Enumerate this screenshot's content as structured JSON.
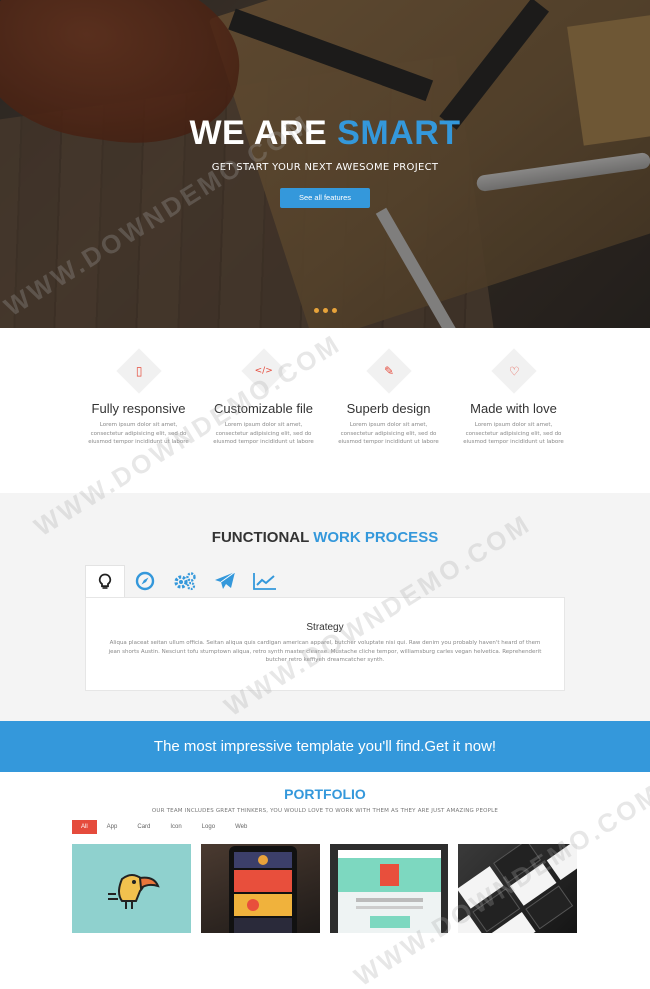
{
  "hero": {
    "title_main": "WE ARE",
    "title_accent": "SMART",
    "subtitle": "GET START YOUR NEXT AWESOME PROJECT",
    "button_label": "See all features",
    "slides": 3
  },
  "features": [
    {
      "icon": "mobile-icon",
      "glyph": "▯",
      "title": "Fully responsive",
      "text": "Lorem ipsum dolor sit amet, consectetur adipisicing elit, sed do eiusmod tempor incididunt ut labore"
    },
    {
      "icon": "code-icon",
      "glyph": "</>",
      "title": "Customizable file",
      "text": "Lorem ipsum dolor sit amet, consectetur adipisicing elit, sed do eiusmod tempor incididunt ut labore"
    },
    {
      "icon": "paintbrush-icon",
      "glyph": "✎",
      "title": "Superb design",
      "text": "Lorem ipsum dolor sit amet, consectetur adipisicing elit, sed do eiusmod tempor incididunt ut labore"
    },
    {
      "icon": "heart-icon",
      "glyph": "♡",
      "title": "Made with love",
      "text": "Lorem ipsum dolor sit amet, consectetur adipisicing elit, sed do eiusmod tempor incididunt ut labore"
    }
  ],
  "process": {
    "title_main": "FUNCTIONAL",
    "title_accent": "WORK PROCESS",
    "tabs": [
      "lightbulb-icon",
      "compass-icon",
      "gears-icon",
      "paper-plane-icon",
      "chart-line-icon"
    ],
    "active_tab": "Strategy",
    "text": "Aliqua placeat seitan ullum officia. Seitan aliqua quis cardigan american apparel, butcher voluptate nisi qui. Raw denim you probably haven't heard of them jean shorts Austin. Nesciunt tofu stumptown aliqua, retro synth master cleanse. Mustache cliche tempor, williamsburg carles vegan helvetica. Reprehenderit butcher retro keffiyeh dreamcatcher synth."
  },
  "cta": {
    "text": "The most impressive template you'll find.Get it now!"
  },
  "portfolio": {
    "title": "PORTFOLIO",
    "description": "OUR TEAM INCLUDES GREAT THINKERS, YOU WOULD LOVE TO WORK WITH THEM AS THEY ARE JUST AMAZING PEOPLE",
    "filters": [
      "All",
      "App",
      "Card",
      "Icon",
      "Logo",
      "Web"
    ],
    "active_filter": "All"
  },
  "watermark": "WWW.DOWNDEMO.COM",
  "colors": {
    "accent": "#3498db",
    "red": "#e54b3c",
    "slider_dot": "#e8a33a"
  }
}
